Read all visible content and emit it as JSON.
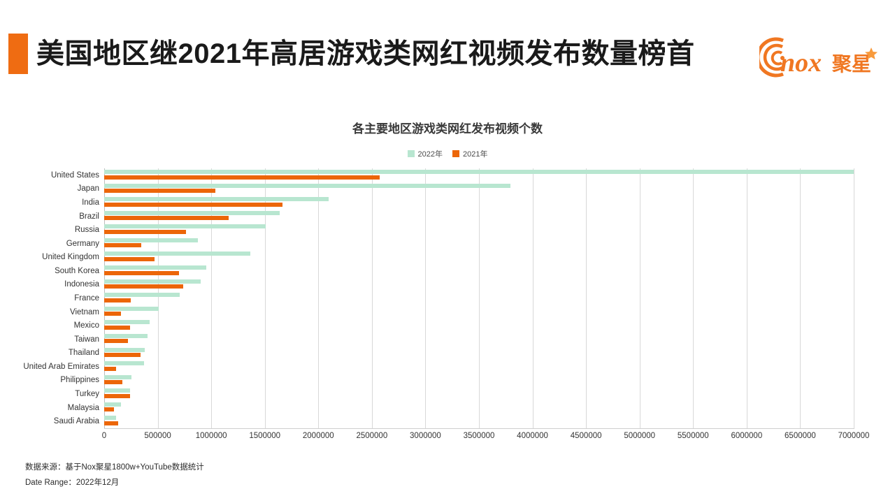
{
  "header": {
    "title": "美国地区继2021年高居游戏类网红视频发布数量榜首",
    "accent_color": "#ef6c12",
    "logo": {
      "name": "nox-juxing-logo",
      "text": "nox 聚星",
      "color": "#f07722"
    }
  },
  "footer": {
    "source_line": "数据来源：基于Nox聚星1800w+YouTube数据统计",
    "date_line": "Date Range：2022年12月"
  },
  "chart_data": {
    "type": "bar",
    "orientation": "horizontal",
    "title": "各主要地区游戏类网红发布视频个数",
    "xlabel": "",
    "ylabel": "",
    "xlim": [
      0,
      7000000
    ],
    "xticks": [
      0,
      500000,
      1000000,
      1500000,
      2000000,
      2500000,
      3000000,
      3500000,
      4000000,
      4500000,
      5000000,
      5500000,
      6000000,
      6500000,
      7000000
    ],
    "xtick_labels": [
      "0",
      "500000",
      "1000000",
      "1500000",
      "2000000",
      "2500000",
      "3000000",
      "3500000",
      "4000000",
      "4500000",
      "5000000",
      "5500000",
      "6000000",
      "6500000",
      "7000000"
    ],
    "grid": true,
    "legend_position": "top-center",
    "colors": {
      "2022": "#b8e6d0",
      "2021": "#ec6608"
    },
    "categories": [
      "United States",
      "Japan",
      "India",
      "Brazil",
      "Russia",
      "Germany",
      "United Kingdom",
      "South Korea",
      "Indonesia",
      "France",
      "Vietnam",
      "Mexico",
      "Taiwan",
      "Thailand",
      "United Arab Emirates",
      "Philippines",
      "Turkey",
      "Malaysia",
      "Saudi Arabia"
    ],
    "series": [
      {
        "name": "2022年",
        "color": "#b8e6d0",
        "values": [
          7000000,
          3794000,
          2097000,
          1639000,
          1508000,
          874000,
          1366000,
          954000,
          901000,
          704000,
          509000,
          424000,
          403000,
          378000,
          375000,
          254000,
          241000,
          157000,
          109000
        ]
      },
      {
        "name": "2021年",
        "color": "#ec6608",
        "values": [
          2573000,
          1039000,
          1665000,
          1162000,
          763000,
          347000,
          470000,
          698000,
          741000,
          248000,
          156000,
          239000,
          219000,
          339000,
          113000,
          167000,
          241000,
          91000,
          130000
        ]
      }
    ]
  }
}
